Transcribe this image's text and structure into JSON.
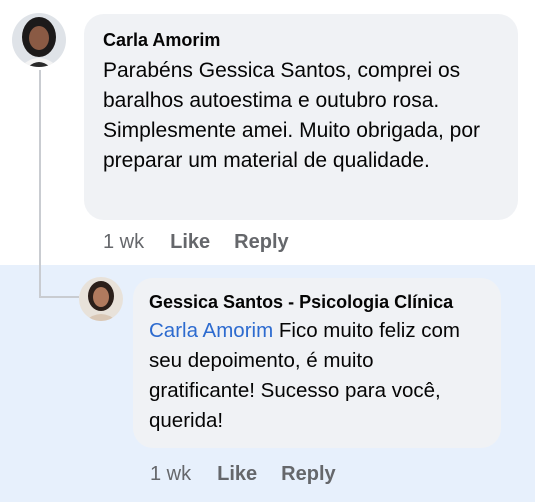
{
  "comment": {
    "author": "Carla Amorim",
    "text": "Parabéns Gessica Santos, comprei os baralhos autoestima e outubro rosa. Simplesmente amei. Muito obrigada, por preparar um material de qualidade.",
    "time": "1 wk",
    "like_label": "Like",
    "reply_label": "Reply"
  },
  "reply": {
    "author": "Gessica Santos - Psicologia Clínica",
    "mention": "Carla Amorim",
    "text": " Fico muito feliz com seu depoimento, é muito gratificante! Sucesso para você, querida!",
    "time": "1 wk",
    "like_label": "Like",
    "reply_label": "Reply"
  },
  "colors": {
    "bubble": "#f0f2f5",
    "reply_highlight": "#e7f0fc",
    "mention": "#2d6bcf",
    "meta": "#65676b"
  }
}
